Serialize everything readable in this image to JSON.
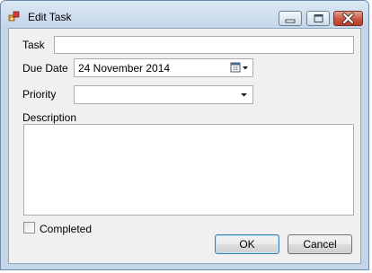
{
  "window": {
    "title": "Edit Task"
  },
  "form": {
    "task_label": "Task",
    "task_value": "",
    "due_date_label": "Due Date",
    "due_date_value": "24 November 2014",
    "priority_label": "Priority",
    "priority_value": "",
    "description_label": "Description",
    "description_value": "",
    "completed_label": "Completed",
    "completed_checked": false
  },
  "buttons": {
    "ok_label": "OK",
    "cancel_label": "Cancel"
  },
  "icons": {
    "app": "app-icon",
    "minimize": "minimize-icon",
    "maximize": "maximize-icon",
    "close": "close-icon",
    "calendar": "calendar-icon",
    "dropdown": "chevron-down-icon"
  },
  "colors": {
    "close_button": "#c8533f",
    "ok_focus": "#3c7fb1",
    "window_frame": "#c4d5e8"
  }
}
